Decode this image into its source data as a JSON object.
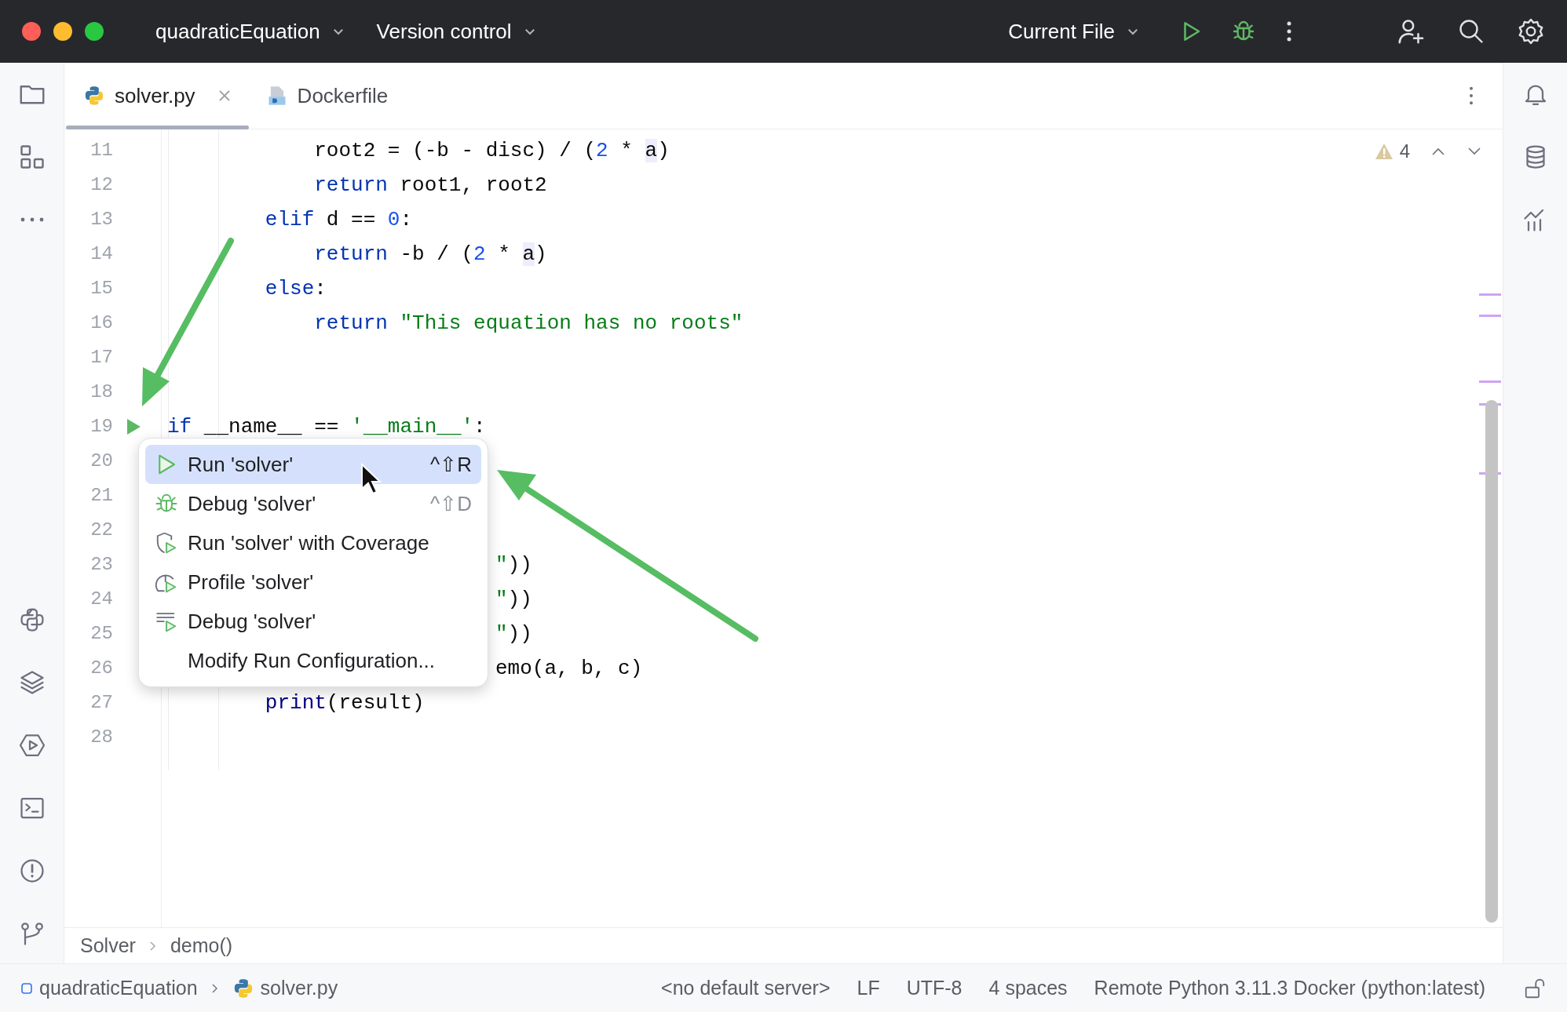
{
  "title_bar": {
    "project": "quadraticEquation",
    "vcs": "Version control",
    "run_config": "Current File"
  },
  "tabs": [
    {
      "label": "solver.py",
      "kind": "python",
      "selected": true,
      "closable": true
    },
    {
      "label": "Dockerfile",
      "kind": "docker",
      "selected": false,
      "closable": false
    }
  ],
  "inspections": {
    "warnings": "4"
  },
  "editor": {
    "lines": [
      {
        "number": "11",
        "tokens": [
          {
            "text": "            root2 = (-b - disc) / (",
            "kind": "plain"
          },
          {
            "text": "2",
            "kind": "number"
          },
          {
            "text": " * ",
            "kind": "plain"
          },
          {
            "text": "a",
            "kind": "param"
          },
          {
            "text": ")",
            "kind": "plain"
          }
        ]
      },
      {
        "number": "12",
        "tokens": [
          {
            "text": "            return",
            "kind": "keyword"
          },
          {
            "text": " root1, root2",
            "kind": "plain"
          }
        ]
      },
      {
        "number": "13",
        "tokens": [
          {
            "text": "        elif",
            "kind": "keyword"
          },
          {
            "text": " d == ",
            "kind": "plain"
          },
          {
            "text": "0",
            "kind": "number"
          },
          {
            "text": ":",
            "kind": "plain"
          }
        ]
      },
      {
        "number": "14",
        "tokens": [
          {
            "text": "            return",
            "kind": "keyword"
          },
          {
            "text": " -b / (",
            "kind": "plain"
          },
          {
            "text": "2",
            "kind": "number"
          },
          {
            "text": " * ",
            "kind": "plain"
          },
          {
            "text": "a",
            "kind": "param"
          },
          {
            "text": ")",
            "kind": "plain"
          }
        ]
      },
      {
        "number": "15",
        "tokens": [
          {
            "text": "        else",
            "kind": "keyword"
          },
          {
            "text": ":",
            "kind": "plain"
          }
        ]
      },
      {
        "number": "16",
        "tokens": [
          {
            "text": "            return",
            "kind": "keyword"
          },
          {
            "text": " \"This equation has no roots\"",
            "kind": "string"
          }
        ]
      },
      {
        "number": "17"
      },
      {
        "number": "18"
      },
      {
        "number": "19",
        "run_marker": true,
        "tokens": [
          {
            "text": "if",
            "kind": "keyword"
          },
          {
            "text": " __name__ == ",
            "kind": "plain"
          },
          {
            "text": "'__main__'",
            "kind": "string"
          },
          {
            "text": ":",
            "kind": "plain"
          }
        ]
      },
      {
        "number": "20"
      },
      {
        "number": "21"
      },
      {
        "number": "22"
      },
      {
        "number": "23",
        "partly_covered": true,
        "tokens": [
          {
            "text": "\"",
            "kind": "string"
          },
          {
            "text": "))",
            "kind": "plain"
          }
        ]
      },
      {
        "number": "24",
        "partly_covered": true,
        "tokens": [
          {
            "text": "\"",
            "kind": "string"
          },
          {
            "text": "))",
            "kind": "plain"
          }
        ]
      },
      {
        "number": "25",
        "partly_covered": true,
        "tokens": [
          {
            "text": "\"",
            "kind": "string"
          },
          {
            "text": "))",
            "kind": "plain"
          }
        ]
      },
      {
        "number": "26",
        "partly_covered": true,
        "tokens": [
          {
            "text": "emo(a, b, c)",
            "kind": "plain"
          }
        ]
      },
      {
        "number": "27",
        "tokens": [
          {
            "text": "        print",
            "kind": "builtin"
          },
          {
            "text": "(result)",
            "kind": "plain"
          }
        ]
      },
      {
        "number": "28"
      }
    ]
  },
  "context_menu": {
    "items": [
      {
        "label": "Run 'solver'",
        "kind": "run",
        "shortcut": "^⇧R",
        "selected": true
      },
      {
        "label": "Debug 'solver'",
        "kind": "debug",
        "shortcut": "^⇧D",
        "selected": false
      },
      {
        "label": "Run 'solver' with Coverage",
        "kind": "coverage",
        "selected": false
      },
      {
        "label": "Profile 'solver'",
        "kind": "profile",
        "selected": false
      },
      {
        "label": "Debug 'solver'",
        "kind": "concurrency",
        "selected": false
      },
      {
        "label": "Modify Run Configuration...",
        "kind": "plain",
        "selected": false
      }
    ]
  },
  "breadcrumbs": [
    "Solver",
    "demo()"
  ],
  "status_bar": {
    "path": [
      {
        "label": "quadraticEquation",
        "kind": "module"
      },
      {
        "label": "solver.py",
        "kind": "python"
      }
    ],
    "widgets": [
      "<no default server>",
      "LF",
      "UTF-8",
      "4 spaces",
      "Remote Python 3.11.3 Docker (python:latest)"
    ]
  }
}
